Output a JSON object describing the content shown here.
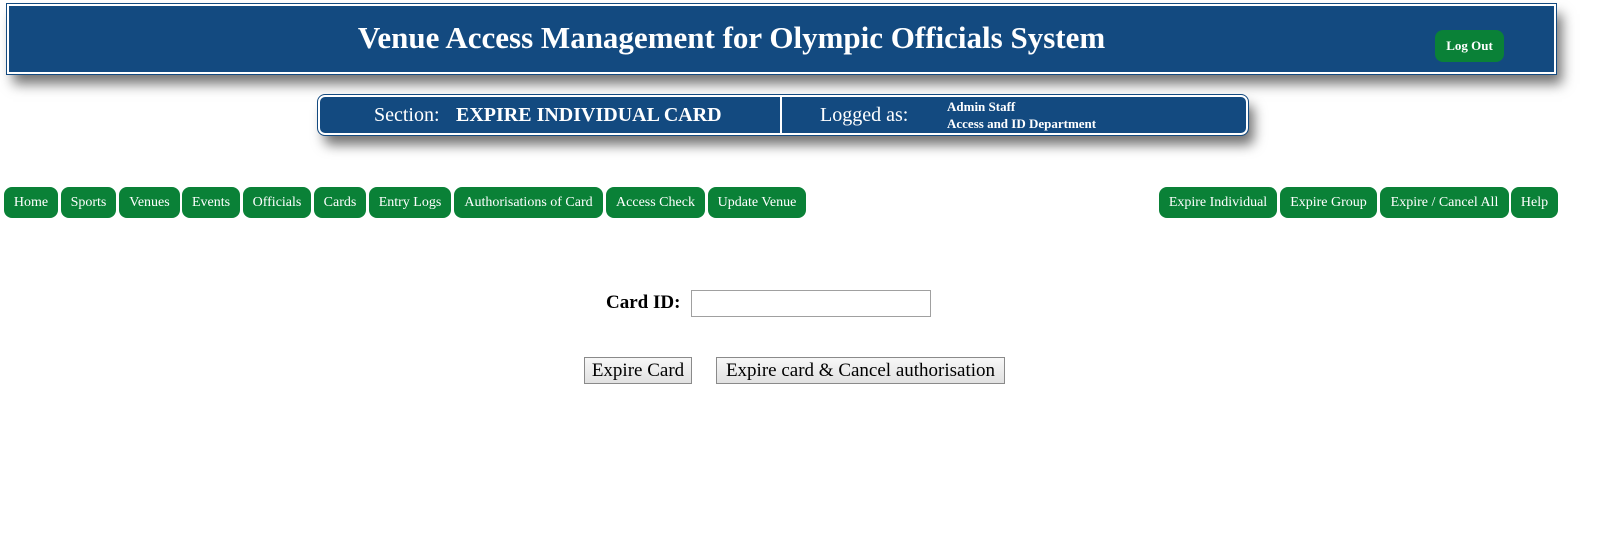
{
  "header": {
    "title": "Venue Access Management for Olympic Officials System",
    "logout_label": "Log Out"
  },
  "section_bar": {
    "section_label": "Section:",
    "section_value": "EXPIRE INDIVIDUAL CARD",
    "logged_label": "Logged as:",
    "user_name": "Admin Staff",
    "department": "Access and ID Department"
  },
  "nav": {
    "left_items": [
      "Home",
      "Sports",
      "Venues",
      "Events",
      "Officials",
      "Cards",
      "Entry Logs",
      "Authorisations of Card",
      "Access Check",
      "Update Venue"
    ],
    "right_items": [
      "Expire Individual",
      "Expire Group",
      "Expire / Cancel All",
      "Help"
    ]
  },
  "form": {
    "card_id_label": "Card ID:",
    "card_id_value": "",
    "expire_button": "Expire Card",
    "expire_cancel_button": "Expire card & Cancel authorisation"
  },
  "colors": {
    "header_blue": "#134a80",
    "nav_green": "#0a8137"
  }
}
